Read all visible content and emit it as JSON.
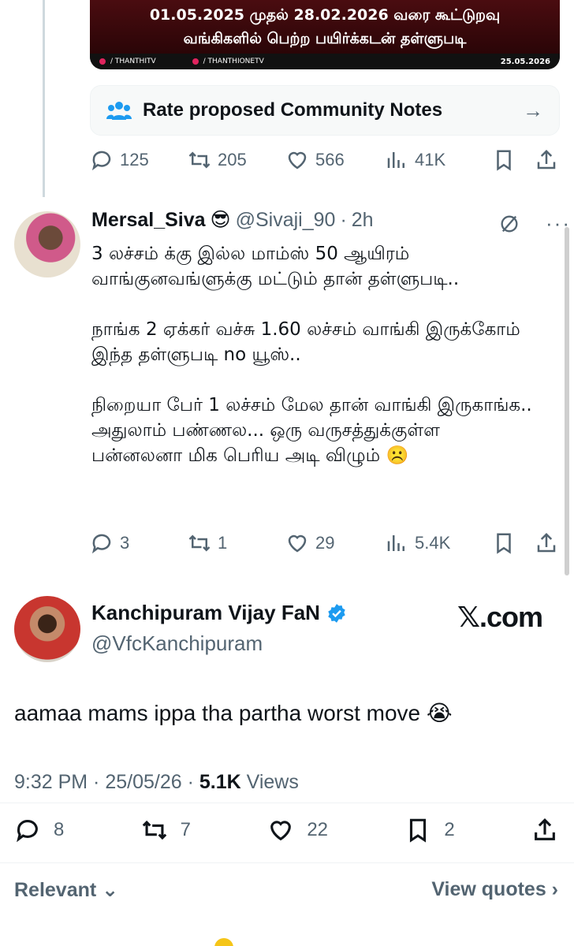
{
  "news_image": {
    "line1": "01.05.2025 முதல் 28.02.2026 வரை கூட்டுறவு",
    "line2": "வங்கிகளில் பெற்ற பயிர்க்கடன் தள்ளுபடி",
    "footer_left": "/ THANTHITV",
    "footer_mid": "/ THANTHIONETV",
    "date": "25.05.2026"
  },
  "community_notes": {
    "label": "Rate proposed Community Notes",
    "icon": "people-icon",
    "arrow": "→"
  },
  "quoted_actions": {
    "replies": "125",
    "reposts": "205",
    "likes": "566",
    "views": "41K"
  },
  "reply": {
    "name": "Mersal_Siva",
    "emoji": "😎",
    "handle": "@Sivaji_90",
    "time": "2h",
    "body": "3 லச்சம் க்கு இல்ல மாம்ஸ் 50 ஆயிரம் வாங்குனவங்ளுக்கு மட்டும் தான் தள்ளுபடி..\n\nநாங்க  2 ஏக்கர் வச்சு 1.60 லச்சம் வாங்கி இருக்கோம் இந்த தள்ளுபடி no யூஸ்..\n\nநிறையா பேர் 1 லச்சம் மேல தான் வாங்கி இருகாங்க.. அதுலாம் பண்ணல... ஒரு வருசத்துக்குள்ள பன்னலனா மிக பெரிய அடி விழும் ☹️",
    "actions": {
      "replies": "3",
      "reposts": "1",
      "likes": "29",
      "views": "5.4K"
    }
  },
  "main_tweet": {
    "name": "Kanchipuram Vijay FaN",
    "handle": "@VfcKanchipuram",
    "watermark": "𝕏.com",
    "text": "aamaa mams ippa tha partha worst move 😭",
    "time": "9:32 PM · 25/05/26 · ",
    "views_count": "5.1K",
    "views_label": " Views",
    "actions": {
      "replies": "8",
      "reposts": "7",
      "likes": "22",
      "bookmarks": "2"
    }
  },
  "sort": {
    "label": "Relevant ⌄",
    "quotes": "View quotes ›"
  },
  "colors": {
    "accent": "#1d9bf0",
    "muted": "#536471",
    "text": "#0f1419"
  }
}
